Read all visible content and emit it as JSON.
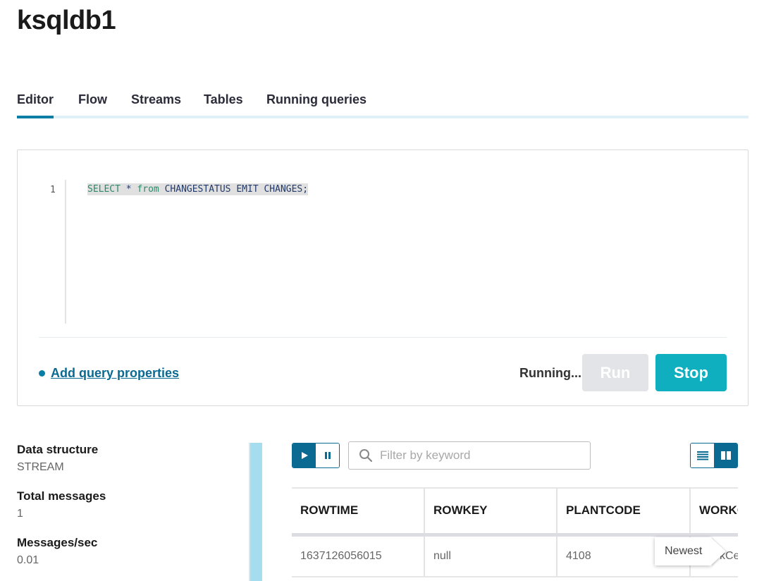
{
  "page": {
    "title": "ksqldb1"
  },
  "tabs": [
    {
      "label": "Editor",
      "active": true
    },
    {
      "label": "Flow",
      "active": false
    },
    {
      "label": "Streams",
      "active": false
    },
    {
      "label": "Tables",
      "active": false
    },
    {
      "label": "Running queries",
      "active": false
    }
  ],
  "editor": {
    "line_number": "1",
    "tokens": {
      "select": "SELECT",
      "star": " * ",
      "from": "from",
      "rest": " CHANGESTATUS EMIT CHANGES;"
    }
  },
  "query_properties": {
    "label": "Add query properties"
  },
  "status": {
    "text": "Running..."
  },
  "buttons": {
    "run": "Run",
    "stop": "Stop"
  },
  "stats": {
    "data_structure": {
      "label": "Data structure",
      "value": "STREAM"
    },
    "total_messages": {
      "label": "Total messages",
      "value": "1"
    },
    "messages_per_sec": {
      "label": "Messages/sec",
      "value": "0.01"
    }
  },
  "filter": {
    "placeholder": "Filter by keyword",
    "value": ""
  },
  "table": {
    "columns": [
      "ROWTIME",
      "ROWKEY",
      "PLANTCODE",
      "WORKCENTER"
    ],
    "rows": [
      [
        "1637126056015",
        "null",
        "4108",
        "WorkCe"
      ]
    ]
  },
  "tooltip": {
    "text": "Newest"
  },
  "colors": {
    "accent": "#0a7ea4",
    "stop_button": "#0fafbf",
    "run_button_disabled": "#e3e4e8"
  },
  "icons": {
    "play": "play-icon",
    "pause": "pause-icon",
    "search": "search-icon",
    "list_view": "list-view-icon",
    "grid_view": "grid-view-icon"
  }
}
